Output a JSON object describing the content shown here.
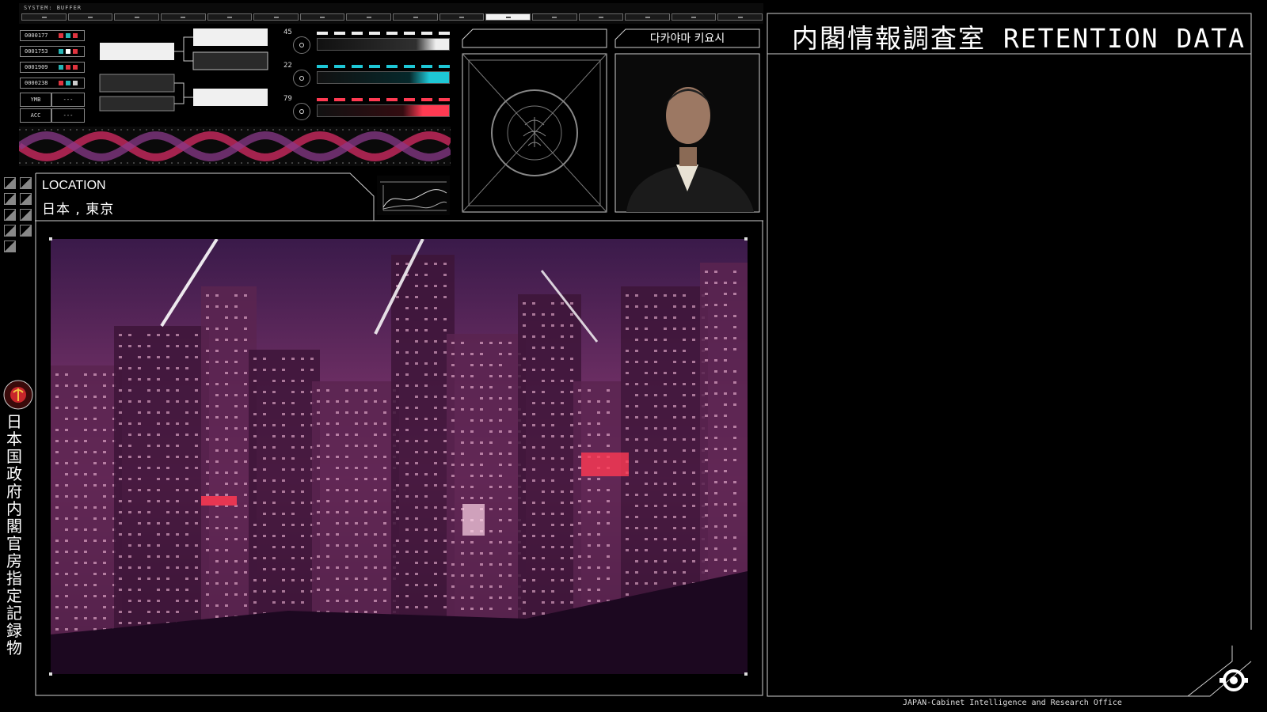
{
  "header": {
    "ruler_title": "SYSTEM: BUFFER",
    "tabs_count": 16,
    "active_tab": 11
  },
  "records": [
    {
      "id": "0000177",
      "colors": [
        "#e0343f",
        "#28b5b5",
        "#e0343f"
      ]
    },
    {
      "id": "0001753",
      "colors": [
        "#28b5b5",
        "#ffffff",
        "#e0343f"
      ]
    },
    {
      "id": "0001909",
      "colors": [
        "#28b5b5",
        "#e0343f",
        "#e0343f"
      ]
    },
    {
      "id": "0000238",
      "colors": [
        "#e0343f",
        "#28b5b5",
        "#cccccc"
      ]
    }
  ],
  "fields": [
    {
      "key": "YMB",
      "value": "---"
    },
    {
      "key": "ACC",
      "value": "---"
    }
  ],
  "gauges": [
    {
      "value": "45",
      "color": "#eeeeee",
      "level": 0.9
    },
    {
      "value": "22",
      "color": "#1ec7d6",
      "level": 0.85
    },
    {
      "value": "79",
      "color": "#ff3a52",
      "level": 0.8
    }
  ],
  "location": {
    "label": "LOCATION",
    "value": "日本 , 東京"
  },
  "person": {
    "name": "다카야마 키요시"
  },
  "seal": {
    "text_top": "CABINET INTELLIGENCE AND RESEARCH OFFICE",
    "text_bottom": "JAPAN"
  },
  "right_panel": {
    "title": "内閣情報調査室 RETENTION DATA"
  },
  "sidebar": {
    "vertical_text": "日本国 政府 内閣官房指定記録物"
  },
  "footer": {
    "text": "JAPAN-Cabinet Intelligence and Research Office"
  },
  "colors": {
    "accent_red": "#ff3a52",
    "accent_cyan": "#1ec7d6",
    "city_purple": "#7a2e6a"
  }
}
